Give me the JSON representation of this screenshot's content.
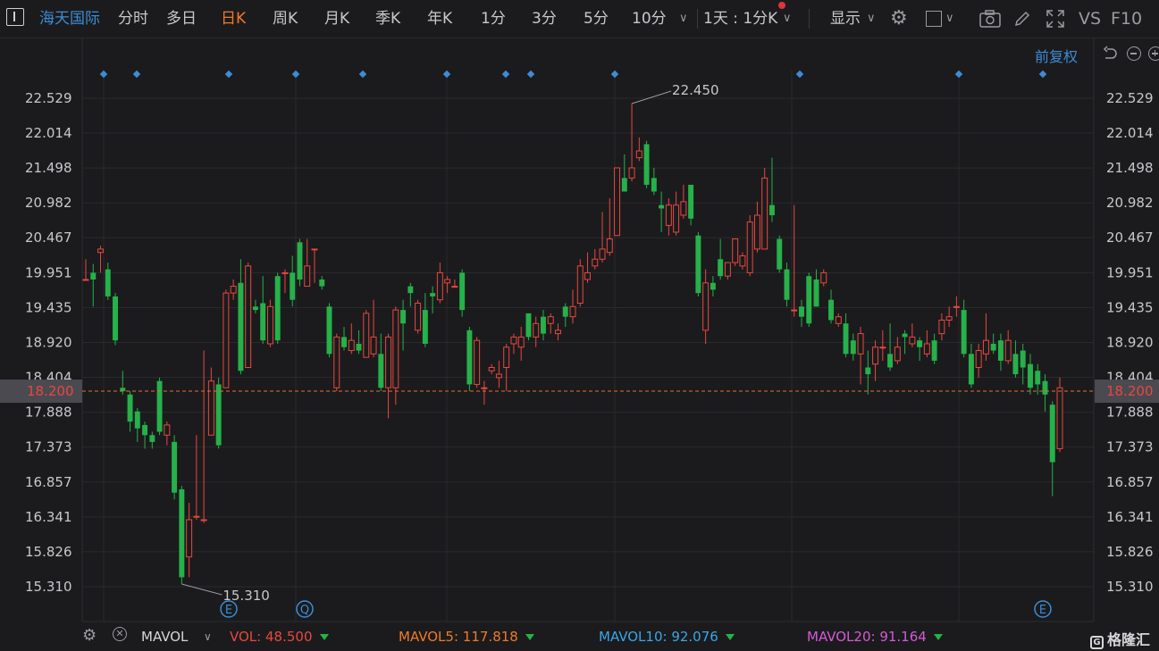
{
  "toolbar": {
    "stock_name": "海天国际",
    "tabs": [
      "分时",
      "多日",
      "日K",
      "周K",
      "月K",
      "季K",
      "年K",
      "1分",
      "3分",
      "5分",
      "10分"
    ],
    "active_tab": "日K",
    "period_select": "1天 : 1分K",
    "display_label": "显示",
    "vs_label": "VS",
    "f10_label": "F10",
    "adjust_label": "前复权"
  },
  "colors": {
    "up": "#e8483e",
    "down": "#26b14a",
    "accent": "#f07a28",
    "blue": "#3d8cd6"
  },
  "chart_data": {
    "type": "candlestick",
    "y_ticks": [
      "22.529",
      "22.014",
      "21.498",
      "20.982",
      "20.467",
      "19.951",
      "19.435",
      "18.920",
      "18.404",
      "17.888",
      "17.373",
      "16.857",
      "16.341",
      "15.826",
      "15.310"
    ],
    "current_price": "18.200",
    "max_label": "22.450",
    "min_label": "15.310",
    "grid": true,
    "event_markers": [
      "E",
      "Q",
      "E"
    ],
    "candles": [
      [
        19.85,
        19.85,
        20.15,
        19.85
      ],
      [
        19.95,
        19.85,
        20.08,
        19.45
      ],
      [
        20.25,
        20.3,
        20.35,
        19.95
      ],
      [
        20.0,
        19.6,
        20.1,
        19.55
      ],
      [
        19.6,
        18.95,
        19.65,
        18.88
      ],
      [
        18.25,
        18.2,
        18.5,
        18.15
      ],
      [
        18.15,
        17.75,
        18.2,
        17.6
      ],
      [
        17.9,
        17.65,
        17.95,
        17.45
      ],
      [
        17.7,
        17.55,
        17.75,
        17.35
      ],
      [
        17.55,
        17.45,
        17.6,
        17.35
      ],
      [
        18.35,
        17.6,
        18.4,
        17.55
      ],
      [
        17.55,
        17.7,
        17.75,
        17.4
      ],
      [
        17.45,
        16.7,
        17.55,
        16.6
      ],
      [
        16.75,
        15.45,
        16.8,
        15.35
      ],
      [
        15.75,
        16.3,
        16.55,
        15.45
      ],
      [
        16.35,
        16.35,
        17.55,
        16.3
      ],
      [
        16.3,
        16.3,
        18.8,
        16.25
      ],
      [
        17.55,
        18.35,
        18.55,
        17.55
      ],
      [
        18.3,
        17.4,
        18.4,
        17.35
      ],
      [
        18.25,
        19.65,
        19.7,
        18.25
      ],
      [
        19.65,
        19.75,
        19.85,
        19.55
      ],
      [
        19.8,
        18.5,
        20.15,
        18.45
      ],
      [
        18.55,
        20.05,
        20.1,
        18.55
      ],
      [
        19.45,
        19.4,
        19.55,
        19.35
      ],
      [
        19.5,
        18.95,
        19.9,
        18.9
      ],
      [
        18.9,
        19.45,
        19.55,
        18.85
      ],
      [
        19.9,
        18.95,
        19.95,
        18.9
      ],
      [
        19.95,
        19.95,
        20.0,
        19.65
      ],
      [
        19.95,
        19.55,
        20.2,
        19.45
      ],
      [
        20.4,
        19.85,
        20.45,
        19.75
      ],
      [
        19.75,
        20.05,
        20.45,
        19.75
      ],
      [
        20.3,
        20.3,
        20.3,
        19.8
      ],
      [
        19.85,
        19.75,
        19.9,
        19.7
      ],
      [
        19.45,
        18.75,
        19.5,
        18.7
      ],
      [
        18.25,
        19.0,
        19.05,
        18.2
      ],
      [
        19.0,
        18.85,
        19.15,
        18.8
      ],
      [
        18.8,
        18.95,
        19.2,
        18.75
      ],
      [
        18.9,
        18.8,
        19.1,
        18.75
      ],
      [
        18.7,
        19.35,
        19.4,
        18.7
      ],
      [
        18.75,
        19.0,
        19.55,
        18.7
      ],
      [
        18.75,
        18.25,
        19.05,
        18.2
      ],
      [
        18.25,
        19.0,
        19.05,
        17.8
      ],
      [
        18.25,
        19.4,
        19.45,
        18.0
      ],
      [
        19.4,
        19.2,
        19.55,
        18.8
      ],
      [
        19.75,
        19.65,
        19.8,
        19.45
      ],
      [
        19.1,
        19.5,
        19.55,
        19.05
      ],
      [
        19.4,
        18.9,
        19.65,
        18.85
      ],
      [
        19.65,
        19.6,
        19.75,
        19.35
      ],
      [
        19.55,
        19.95,
        20.1,
        19.5
      ],
      [
        19.8,
        19.85,
        19.9,
        19.65
      ],
      [
        19.75,
        19.75,
        19.85,
        19.75
      ],
      [
        19.95,
        19.4,
        20.0,
        19.3
      ],
      [
        19.1,
        18.3,
        19.15,
        18.2
      ],
      [
        18.3,
        18.95,
        19.0,
        18.25
      ],
      [
        18.25,
        18.25,
        18.35,
        18.0
      ],
      [
        18.5,
        18.55,
        18.6,
        18.45
      ],
      [
        18.4,
        18.45,
        18.65,
        18.25
      ],
      [
        18.55,
        18.85,
        18.9,
        18.2
      ],
      [
        18.9,
        19.0,
        19.05,
        18.75
      ],
      [
        18.85,
        19.0,
        19.15,
        18.65
      ],
      [
        19.35,
        19.0,
        19.35,
        18.95
      ],
      [
        19.0,
        19.2,
        19.3,
        18.85
      ],
      [
        19.3,
        19.05,
        19.4,
        18.95
      ],
      [
        19.2,
        19.3,
        19.35,
        19.05
      ],
      [
        19.05,
        19.1,
        19.2,
        18.95
      ],
      [
        19.45,
        19.3,
        19.5,
        19.15
      ],
      [
        19.3,
        19.45,
        19.7,
        19.2
      ],
      [
        19.5,
        20.05,
        20.15,
        19.45
      ],
      [
        19.85,
        19.95,
        20.25,
        19.8
      ],
      [
        20.05,
        20.15,
        20.3,
        20.0
      ],
      [
        20.15,
        20.3,
        20.85,
        20.1
      ],
      [
        20.25,
        20.45,
        21.05,
        20.2
      ],
      [
        20.5,
        21.5,
        21.5,
        20.5
      ],
      [
        21.35,
        21.15,
        21.7,
        21.3
      ],
      [
        21.35,
        21.5,
        22.45,
        21.3
      ],
      [
        21.65,
        21.75,
        21.95,
        21.6
      ],
      [
        21.85,
        21.25,
        21.9,
        21.2
      ],
      [
        21.35,
        21.15,
        21.5,
        21.1
      ],
      [
        20.95,
        20.9,
        21.15,
        20.55
      ],
      [
        20.65,
        20.95,
        21.05,
        20.5
      ],
      [
        20.55,
        20.95,
        21.15,
        20.5
      ],
      [
        20.8,
        21.0,
        21.25,
        20.75
      ],
      [
        21.25,
        20.75,
        21.25,
        20.65
      ],
      [
        20.5,
        19.65,
        20.55,
        19.6
      ],
      [
        19.1,
        19.8,
        20.0,
        18.9
      ],
      [
        19.8,
        19.7,
        19.9,
        19.6
      ],
      [
        20.15,
        19.9,
        20.45,
        19.85
      ],
      [
        19.9,
        20.1,
        20.1,
        19.85
      ],
      [
        20.1,
        20.45,
        20.45,
        20.05
      ],
      [
        20.05,
        20.2,
        20.25,
        20.0
      ],
      [
        19.95,
        20.7,
        20.8,
        19.9
      ],
      [
        20.3,
        20.8,
        21.0,
        20.25
      ],
      [
        20.3,
        21.35,
        21.5,
        20.3
      ],
      [
        20.95,
        20.8,
        21.65,
        20.7
      ],
      [
        20.45,
        20.0,
        20.5,
        19.95
      ],
      [
        20.0,
        19.55,
        20.1,
        19.45
      ],
      [
        19.4,
        19.4,
        20.95,
        19.3
      ],
      [
        19.45,
        19.3,
        19.55,
        19.15
      ],
      [
        19.9,
        19.2,
        19.95,
        19.15
      ],
      [
        19.85,
        19.45,
        20.0,
        19.45
      ],
      [
        19.8,
        19.95,
        20.0,
        19.75
      ],
      [
        19.55,
        19.25,
        19.7,
        19.2
      ],
      [
        19.2,
        19.3,
        19.35,
        19.15
      ],
      [
        19.2,
        18.75,
        19.35,
        18.7
      ],
      [
        18.95,
        18.75,
        19.05,
        18.65
      ],
      [
        18.75,
        19.05,
        19.15,
        18.3
      ],
      [
        18.55,
        18.45,
        18.8,
        18.15
      ],
      [
        18.6,
        18.85,
        18.95,
        18.35
      ],
      [
        18.85,
        18.85,
        19.1,
        18.65
      ],
      [
        18.75,
        18.55,
        19.2,
        18.5
      ],
      [
        18.65,
        18.85,
        19.0,
        18.6
      ],
      [
        19.05,
        19.0,
        19.1,
        18.75
      ],
      [
        18.9,
        19.0,
        19.2,
        18.85
      ],
      [
        18.95,
        18.85,
        19.0,
        18.65
      ],
      [
        18.75,
        18.9,
        19.1,
        18.7
      ],
      [
        18.95,
        18.65,
        19.05,
        18.6
      ],
      [
        19.05,
        19.25,
        19.35,
        18.95
      ],
      [
        19.25,
        19.3,
        19.45,
        19.15
      ],
      [
        19.45,
        19.45,
        19.6,
        19.3
      ],
      [
        19.4,
        18.75,
        19.55,
        18.7
      ],
      [
        18.75,
        18.3,
        18.9,
        18.25
      ],
      [
        18.55,
        18.8,
        18.9,
        18.4
      ],
      [
        18.75,
        18.95,
        19.35,
        18.65
      ],
      [
        18.9,
        18.8,
        19.05,
        18.75
      ],
      [
        18.95,
        18.65,
        19.05,
        18.5
      ],
      [
        18.65,
        18.95,
        19.1,
        18.6
      ],
      [
        18.75,
        18.45,
        18.95,
        18.4
      ],
      [
        18.8,
        18.55,
        18.9,
        18.3
      ],
      [
        18.6,
        18.25,
        18.75,
        18.15
      ],
      [
        18.5,
        18.3,
        18.6,
        18.15
      ],
      [
        18.35,
        18.15,
        18.45,
        17.9
      ],
      [
        18.0,
        17.15,
        18.05,
        16.65
      ],
      [
        17.35,
        18.25,
        18.4,
        17.3
      ]
    ]
  },
  "bottom": {
    "indicator_name": "MAVOL",
    "vol_label": "VOL:",
    "vol_value": "48.500",
    "mavol5_label": "MAVOL5:",
    "mavol5_value": "117.818",
    "mavol10_label": "MAVOL10:",
    "mavol10_value": "92.076",
    "mavol20_label": "MAVOL20:",
    "mavol20_value": "91.164",
    "logo_text": "格隆汇"
  }
}
